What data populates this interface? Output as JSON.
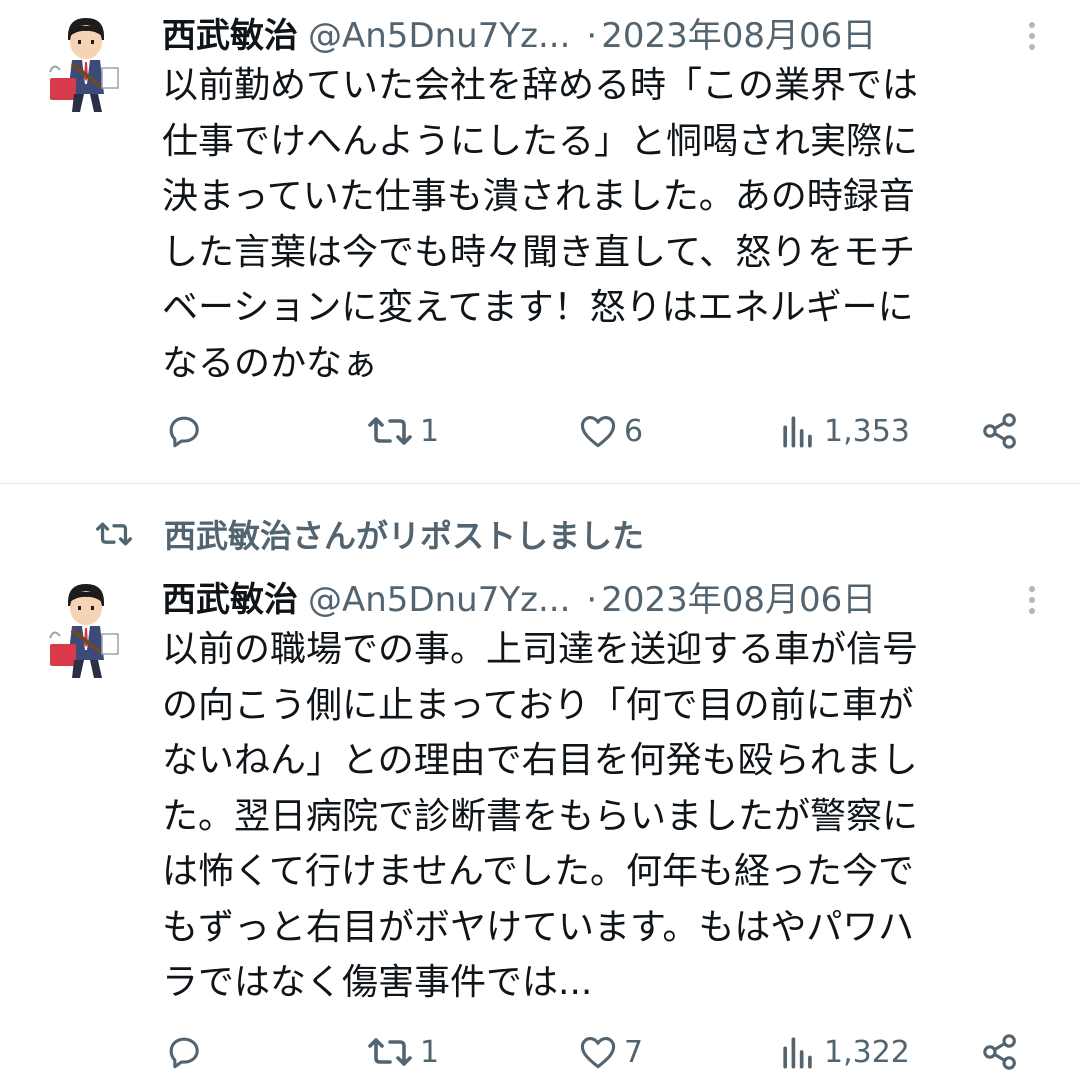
{
  "colors": {
    "text": "#0f1419",
    "secondary": "#536471",
    "divider": "#e6e9eb"
  },
  "tweets": [
    {
      "author_name": "西武敏治",
      "handle": "@An5Dnu7Yz...",
      "separator": "·",
      "date": "2023年08月06日",
      "text": "以前勤めていた会社を辞める時「この業界では\n仕事でけへんようにしたる」と恫喝され実際に\n決まっていた仕事も潰されました。あの時録音\nした言葉は今でも時々聞き直して、怒りをモチ\nベーションに変えてます！怒りはエネルギーに\nなるのかなぁ",
      "reply_count": "",
      "repost_count": "1",
      "like_count": "6",
      "view_count": "1,353"
    },
    {
      "author_name": "西武敏治",
      "handle": "@An5Dnu7Yz...",
      "separator": "·",
      "date": "2023年08月06日",
      "text": "以前の職場での事。上司達を送迎する車が信号\nの向こう側に止まっており「何で目の前に車が\nないねん」との理由で右目を何発も殴られまし\nた。翌日病院で診断書をもらいましたが警察に\nは怖くて行けませんでした。何年も経った今で\nもずっと右目がボヤけています。もはやパワハ\nラではなく傷害事件では...",
      "reply_count": "",
      "repost_count": "1",
      "like_count": "7",
      "view_count": "1,322"
    }
  ],
  "repost_banner": {
    "label": "西武敏治さんがリポストしました",
    "icon": "repost-icon"
  }
}
